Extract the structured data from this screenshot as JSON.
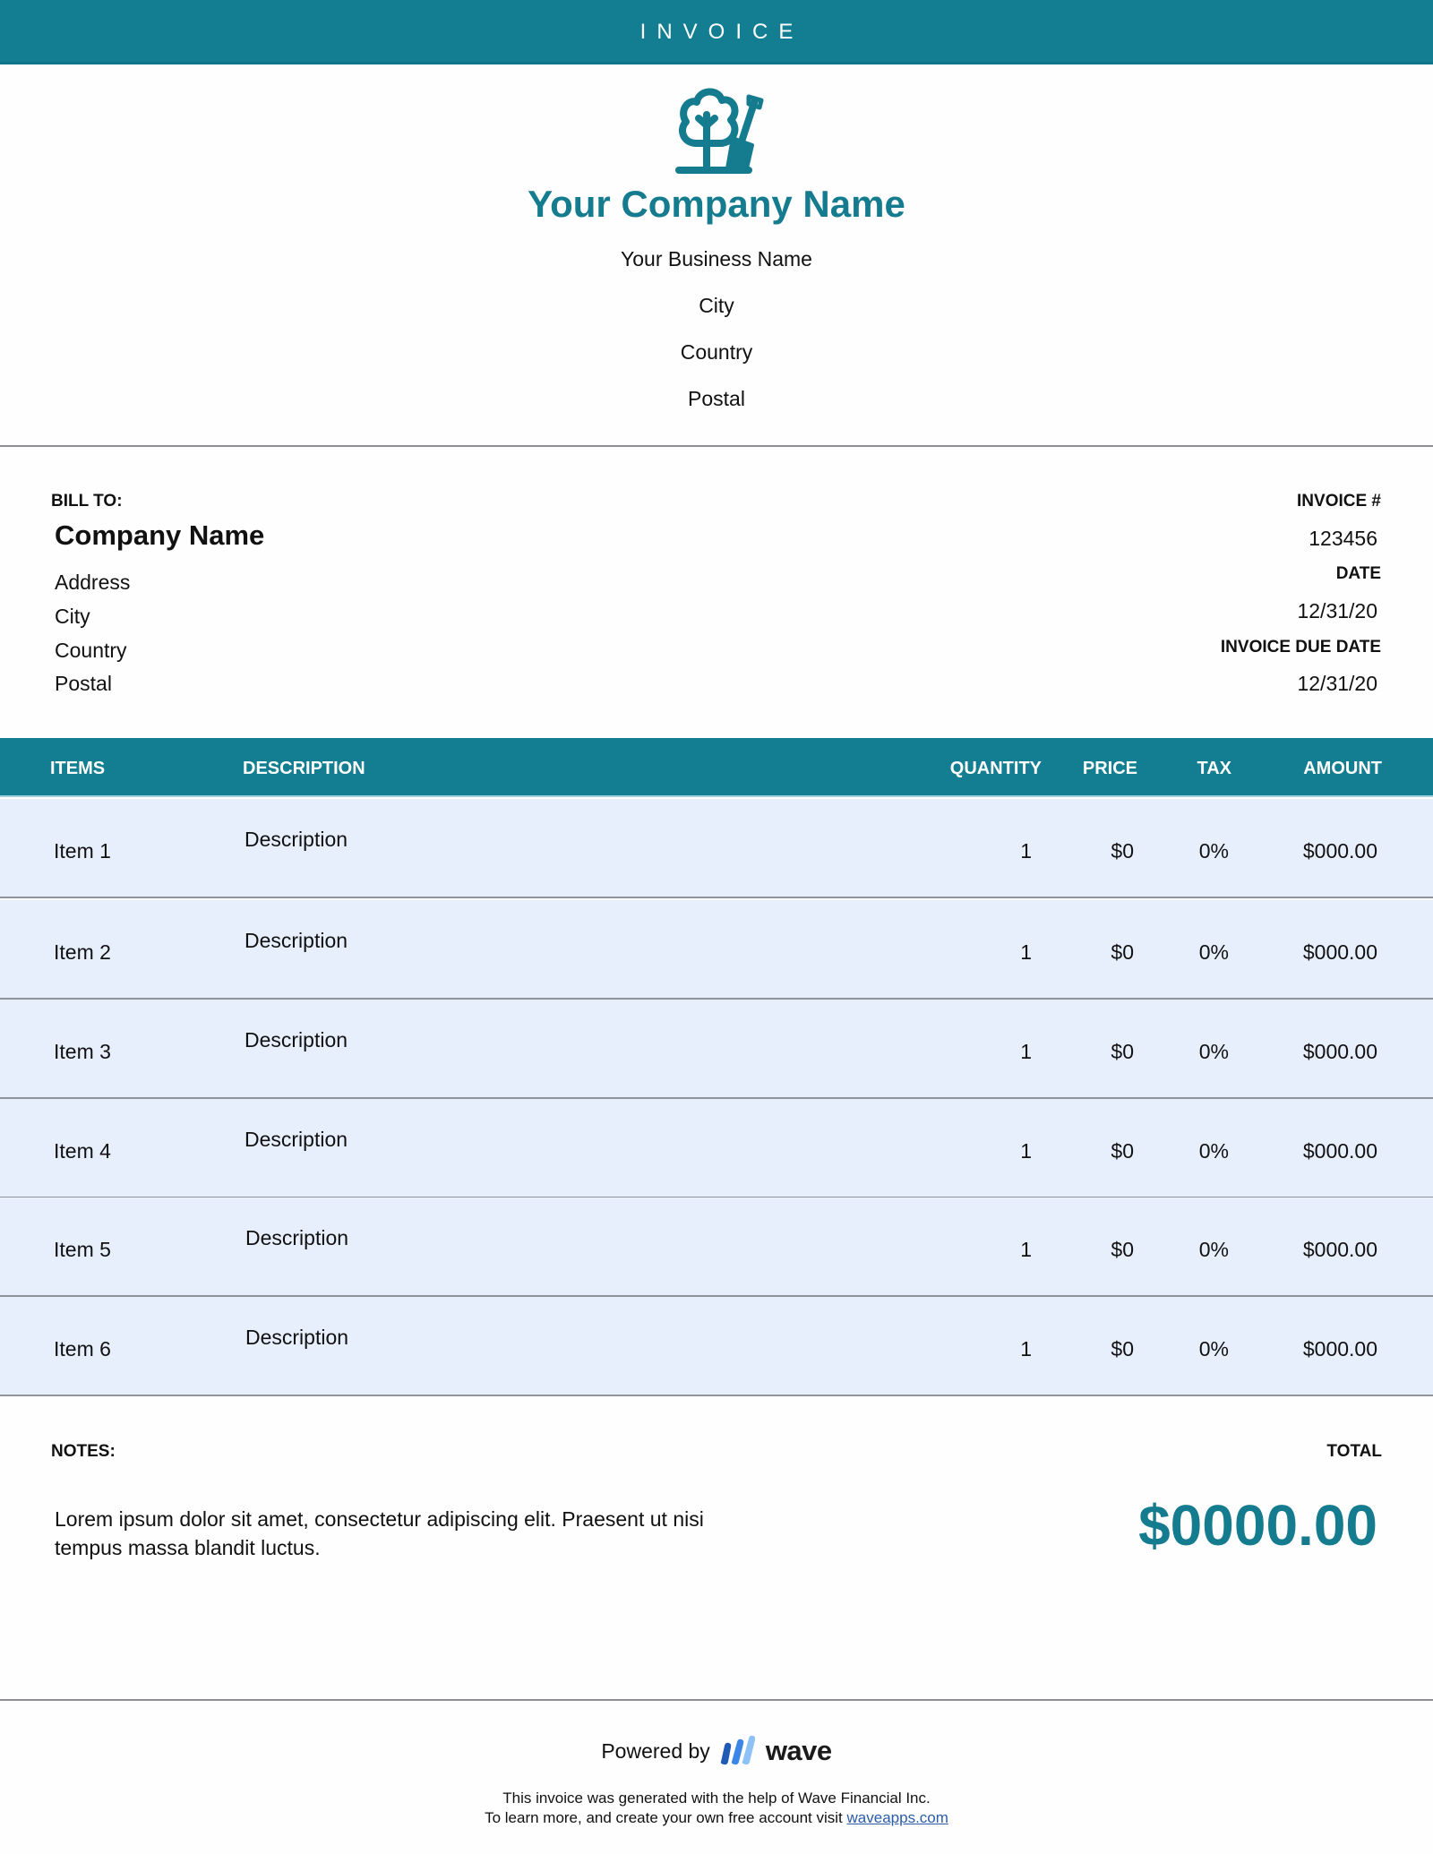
{
  "header": {
    "title": "INVOICE"
  },
  "brand": {
    "logo_icon": "tree-shovel-icon",
    "company_name": "Your Company Name",
    "lines": [
      "Your Business Name",
      "City",
      "Country",
      "Postal"
    ],
    "accent_color": "#137d91"
  },
  "bill_to": {
    "label": "BILL TO:",
    "company": "Company Name",
    "lines": [
      "Address",
      "City",
      "Country",
      "Postal"
    ]
  },
  "meta": {
    "invoice_number_label": "INVOICE #",
    "invoice_number": "123456",
    "date_label": "DATE",
    "date": "12/31/20",
    "due_date_label": "INVOICE DUE DATE",
    "due_date": "12/31/20"
  },
  "table": {
    "columns": [
      "ITEMS",
      "DESCRIPTION",
      "QUANTITY",
      "PRICE",
      "TAX",
      "AMOUNT"
    ],
    "rows": [
      {
        "item": "Item 1",
        "description": "Description",
        "quantity": "1",
        "price": "$0",
        "tax": "0%",
        "amount": "$000.00"
      },
      {
        "item": "Item 2",
        "description": "Description",
        "quantity": "1",
        "price": "$0",
        "tax": "0%",
        "amount": "$000.00"
      },
      {
        "item": "Item 3",
        "description": "Description",
        "quantity": "1",
        "price": "$0",
        "tax": "0%",
        "amount": "$000.00"
      },
      {
        "item": "Item 4",
        "description": "Description",
        "quantity": "1",
        "price": "$0",
        "tax": "0%",
        "amount": "$000.00"
      },
      {
        "item": "Item 5",
        "description": "Description",
        "quantity": "1",
        "price": "$0",
        "tax": "0%",
        "amount": "$000.00"
      },
      {
        "item": "Item 6",
        "description": "Description",
        "quantity": "1",
        "price": "$0",
        "tax": "0%",
        "amount": "$000.00"
      }
    ]
  },
  "notes": {
    "label": "NOTES:",
    "text": "Lorem ipsum dolor sit amet, consectetur adipiscing elit. Praesent ut nisi tempus massa blandit luctus."
  },
  "total": {
    "label": "TOTAL",
    "value": "$0000.00"
  },
  "footer": {
    "powered_by": "Powered by",
    "wave_logo_icon": "wave-logo-icon",
    "wave_word": "wave",
    "line1": "This invoice was generated with the help of Wave Financial Inc.",
    "line2_prefix": "To learn more, and create your own free account visit",
    "link_text": "waveapps.com"
  }
}
